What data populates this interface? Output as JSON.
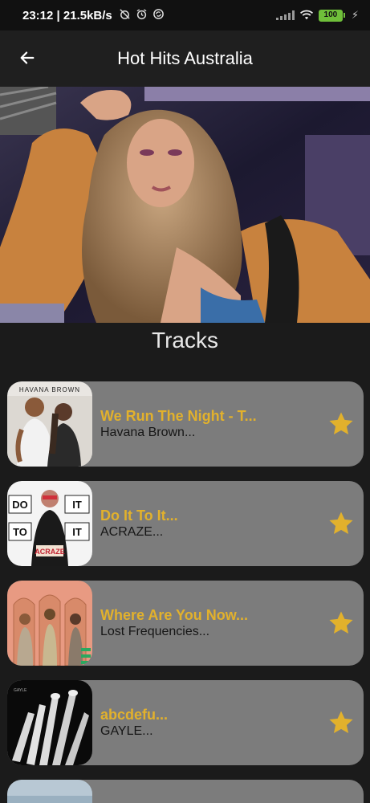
{
  "status_bar": {
    "time_speed": "23:12 | 21.5kB/s",
    "battery": "100",
    "icons": [
      "alarm-off-icon",
      "alarm-icon",
      "sync-icon",
      "signal-icon",
      "wifi-icon",
      "battery-icon",
      "charging-icon"
    ]
  },
  "header": {
    "title": "Hot Hits Australia",
    "back_icon": "arrow-left-icon"
  },
  "section": {
    "title": "Tracks"
  },
  "tracks": [
    {
      "title": "We Run The Night - T...",
      "artist": "Havana Brown...",
      "art_text": "HAVANA BROWN"
    },
    {
      "title": "Do It To It...",
      "artist": "ACRAZE...",
      "art_text": "DO IT TO IT"
    },
    {
      "title": "Where Are You Now...",
      "artist": "Lost Frequencies...",
      "art_text": ""
    },
    {
      "title": "abcdefu...",
      "artist": "GAYLE...",
      "art_text": ""
    }
  ],
  "colors": {
    "background": "#1b1b1b",
    "card": "#7c7c7c",
    "title_accent": "#e2b12c",
    "star": "#e2b12c"
  }
}
